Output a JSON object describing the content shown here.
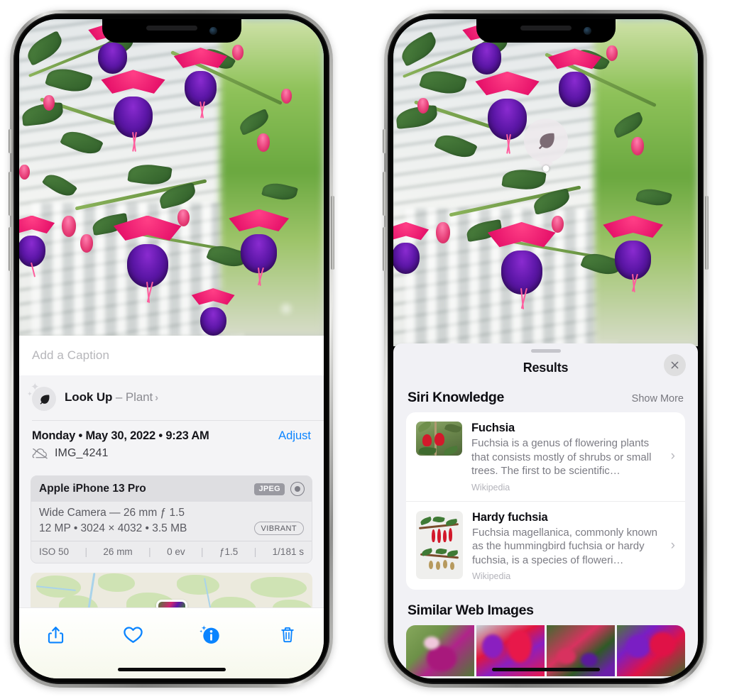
{
  "left_phone": {
    "name": "iphone-photos-info",
    "photo_alt": "fuchsia-flowers-photo",
    "caption": {
      "placeholder": "Add a Caption",
      "value": ""
    },
    "lookup": {
      "label": "Look Up",
      "dash": "–",
      "subject": "Plant",
      "chevron": "›",
      "icon": "leaf-icon"
    },
    "meta": {
      "datetime": "Monday • May 30, 2022 • 9:23 AM",
      "adjust_label": "Adjust",
      "filename": "IMG_4241",
      "cloud_icon": "cloud-slash-icon"
    },
    "camera_card": {
      "model": "Apple iPhone 13 Pro",
      "format_badge": "JPEG",
      "raw_icon": "raw-ring-icon",
      "lens_line": "Wide Camera — 26 mm ƒ 1.5",
      "specs_line": "12 MP • 3024 × 4032 • 3.5 MB",
      "style_badge": "VIBRANT",
      "exif": [
        "ISO 50",
        "26 mm",
        "0 ev",
        "ƒ1.5",
        "1/181 s"
      ]
    },
    "map": {
      "name": "location-map-strip",
      "pin": "photo-thumbnail-pin"
    },
    "toolbar": [
      {
        "name": "share-button",
        "icon": "share-icon"
      },
      {
        "name": "favorite-button",
        "icon": "heart-icon"
      },
      {
        "name": "info-button",
        "icon": "info-sparkle-icon"
      },
      {
        "name": "delete-button",
        "icon": "trash-icon"
      }
    ],
    "accent": "#0a84ff"
  },
  "right_phone": {
    "name": "iphone-visual-lookup-results",
    "badge": {
      "icon": "leaf-icon",
      "name": "visual-lookup-badge"
    },
    "sheet": {
      "grabber": "sheet-grabber",
      "title": "Results",
      "close_icon": "close-icon"
    },
    "siri_section": {
      "title": "Siri Knowledge",
      "show_more": "Show More",
      "cards": [
        {
          "title": "Fuchsia",
          "desc": "Fuchsia is a genus of flowering plants that consists mostly of shrubs or small trees. The first to be scientific…",
          "source": "Wikipedia",
          "thumb": "fuchsia-thumbnail",
          "chevron": "›"
        },
        {
          "title": "Hardy fuchsia",
          "desc": "Fuchsia magellanica, commonly known as the hummingbird fuchsia or hardy fuchsia, is a species of floweri…",
          "source": "Wikipedia",
          "thumb": "hardy-fuchsia-thumbnail",
          "chevron": "›"
        }
      ]
    },
    "web_section": {
      "title": "Similar Web Images",
      "images": [
        {
          "name": "web-image-1"
        },
        {
          "name": "web-image-2"
        },
        {
          "name": "web-image-3"
        },
        {
          "name": "web-image-4"
        }
      ]
    }
  }
}
